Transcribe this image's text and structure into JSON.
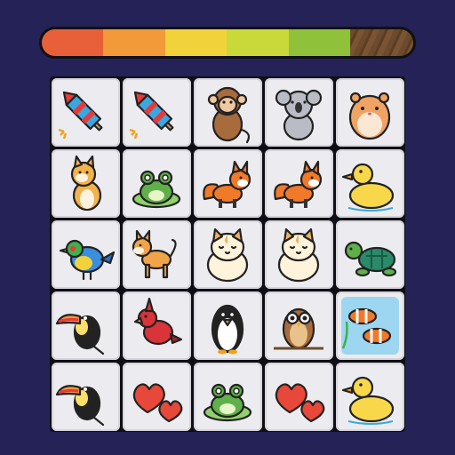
{
  "timer": {
    "segments": [
      "#e8603a",
      "#f29a3a",
      "#f2d23a",
      "#c9d93a",
      "#8fc23a"
    ],
    "fill_fraction": 0.83
  },
  "board": {
    "rows": 5,
    "cols": 5,
    "tiles": [
      [
        "firework-rocket",
        "firework-rocket",
        "monkey",
        "koala",
        "hamster"
      ],
      [
        "shiba-sitting",
        "frog",
        "fox",
        "fox",
        "duck"
      ],
      [
        "finch-bird",
        "shiba-standing",
        "cat",
        "cat",
        "turtle"
      ],
      [
        "toucan",
        "cardinal",
        "penguin",
        "owl",
        "clownfish"
      ],
      [
        "toucan",
        "hearts",
        "frog",
        "hearts",
        "duck"
      ]
    ]
  }
}
